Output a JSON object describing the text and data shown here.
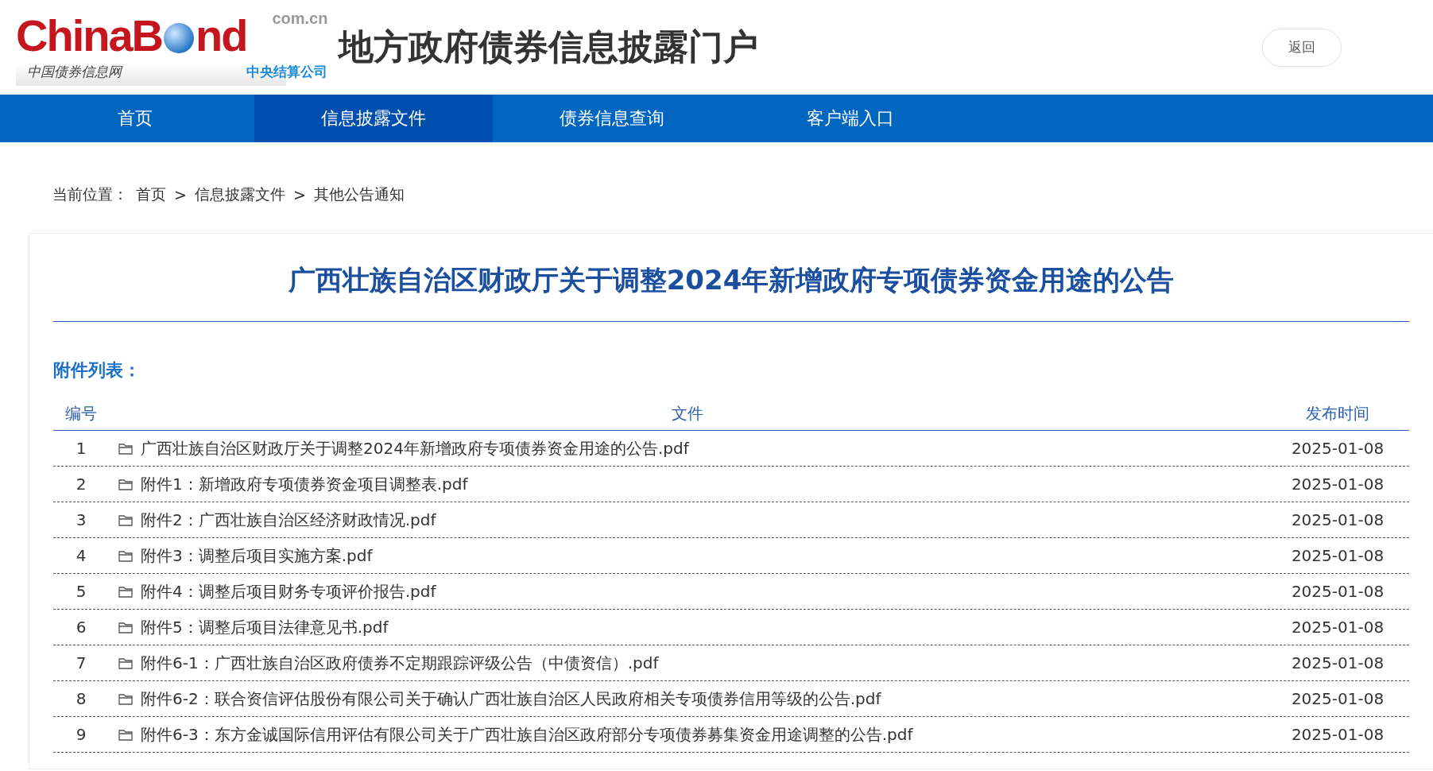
{
  "logo": {
    "brand_left": "China",
    "brand_b": "B",
    "brand_right": "nd",
    "domain": "com.cn",
    "tagline": "中国债券信息网",
    "company": "中央结算公司"
  },
  "site_title": "地方政府债券信息披露门户",
  "back_button": "返回",
  "nav": [
    {
      "label": "首页",
      "selected": false
    },
    {
      "label": "信息披露文件",
      "selected": true
    },
    {
      "label": "债券信息查询",
      "selected": false
    },
    {
      "label": "客户端入口",
      "selected": false
    }
  ],
  "breadcrumb": {
    "label": "当前位置：",
    "items": [
      "首页",
      "信息披露文件",
      "其他公告通知"
    ],
    "separator": ">"
  },
  "article_title": "广西壮族自治区财政厅关于调整2024年新增政府专项债券资金用途的公告",
  "attachments_heading": "附件列表：",
  "table": {
    "columns": [
      "编号",
      "文件",
      "发布时间"
    ],
    "rows": [
      {
        "no": "1",
        "file": "广西壮族自治区财政厅关于调整2024年新增政府专项债券资金用途的公告.pdf",
        "date": "2025-01-08"
      },
      {
        "no": "2",
        "file": "附件1：新增政府专项债券资金项目调整表.pdf",
        "date": "2025-01-08"
      },
      {
        "no": "3",
        "file": "附件2：广西壮族自治区经济财政情况.pdf",
        "date": "2025-01-08"
      },
      {
        "no": "4",
        "file": "附件3：调整后项目实施方案.pdf",
        "date": "2025-01-08"
      },
      {
        "no": "5",
        "file": "附件4：调整后项目财务专项评价报告.pdf",
        "date": "2025-01-08"
      },
      {
        "no": "6",
        "file": "附件5：调整后项目法律意见书.pdf",
        "date": "2025-01-08"
      },
      {
        "no": "7",
        "file": "附件6-1：广西壮族自治区政府债券不定期跟踪评级公告（中债资信）.pdf",
        "date": "2025-01-08"
      },
      {
        "no": "8",
        "file": "附件6-2：联合资信评估股份有限公司关于确认广西壮族自治区人民政府相关专项债券信用等级的公告.pdf",
        "date": "2025-01-08"
      },
      {
        "no": "9",
        "file": "附件6-3：东方金诚国际信用评估有限公司关于广西壮族自治区政府部分专项债券募集资金用途调整的公告.pdf",
        "date": "2025-01-08"
      }
    ]
  }
}
